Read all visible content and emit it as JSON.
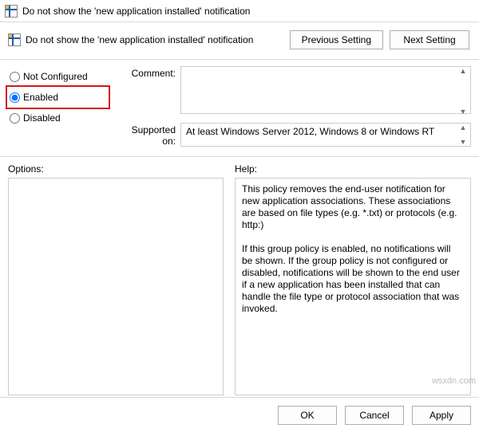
{
  "window": {
    "title": "Do not show the 'new application installed' notification"
  },
  "header": {
    "policy_title": "Do not show the 'new application installed' notification",
    "prev_btn": "Previous Setting",
    "next_btn": "Next Setting"
  },
  "state": {
    "not_configured": "Not Configured",
    "enabled": "Enabled",
    "disabled": "Disabled",
    "selected": "enabled"
  },
  "comment": {
    "label": "Comment:",
    "value": ""
  },
  "supported": {
    "label": "Supported on:",
    "value": "At least Windows Server 2012, Windows 8 or Windows RT"
  },
  "options": {
    "label": "Options:",
    "content": ""
  },
  "help": {
    "label": "Help:",
    "paragraph1": "This policy removes the end-user notification for new application associations. These associations are based on file types (e.g. *.txt) or protocols (e.g. http:)",
    "paragraph2": "If this group policy is enabled, no notifications will be shown. If the group policy is not configured or disabled, notifications will be shown to the end user if a new application has been installed that can handle the file type or protocol association that was invoked."
  },
  "footer": {
    "ok": "OK",
    "cancel": "Cancel",
    "apply": "Apply"
  },
  "watermark": "wsxdn.com"
}
